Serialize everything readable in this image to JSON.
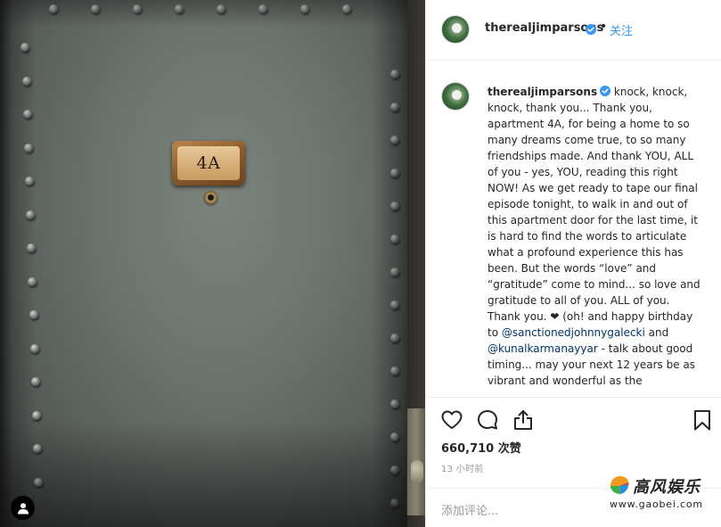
{
  "photo": {
    "door_number": "4A"
  },
  "header": {
    "username": "therealjimparsons",
    "dot": "•",
    "follow_label": "关注"
  },
  "post": {
    "username": "therealjimparsons",
    "caption_part1": " knock, knock, knock, thank you... Thank you, apartment 4A, for being a home to so many dreams come true, to so many friendships made. And thank YOU, ALL of you - yes, YOU, reading this right NOW! As we get ready to tape our final episode tonight, to walk in and out of this apartment door for the last time, it is hard to find the words to articulate what a profound experience this has been. But the words “love” and “gratitude” come to mind... so love and gratitude to all of you. ALL of you. Thank you. ❤ (oh! and happy birthday to ",
    "mention1": "@sanctionedjohnnygalecki",
    "caption_part2": " and ",
    "mention2": "@kunalkarmanayyar",
    "caption_part3": " - talk about good timing... may your next 12 years be as vibrant and wonderful as the"
  },
  "actions": {
    "likes": "660,710 次赞",
    "time": "13 小时前",
    "comment_placeholder": "添加评论..."
  },
  "watermark": {
    "logo_text": "高风娱乐",
    "url": "www.gaobei.com"
  },
  "colors": {
    "link_blue": "#3897f0",
    "verified_blue": "#3897f0",
    "mention_navy": "#003569",
    "text": "#262626",
    "muted": "#999999"
  }
}
